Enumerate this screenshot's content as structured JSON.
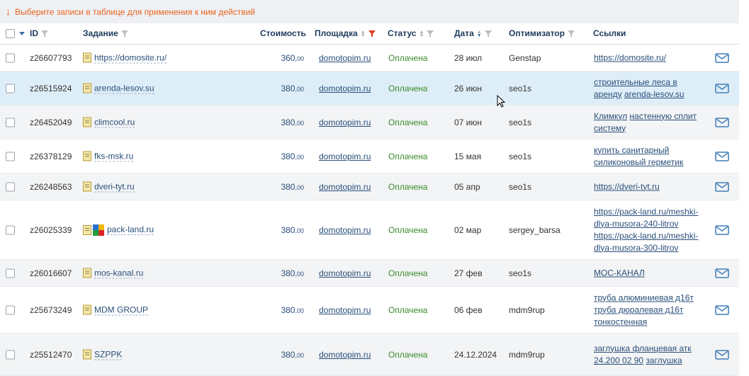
{
  "hint": {
    "arrow": "↓",
    "text": "Выберите записи в таблице для применения к ним действий"
  },
  "columns": {
    "id": "ID",
    "task": "Задание",
    "price": "Стоимость",
    "site": "Площадка",
    "status": "Статус",
    "date": "Дата",
    "optimizer": "Оптимизатор",
    "links": "Ссылки"
  },
  "colors": {
    "header": "#1e3a5c",
    "link": "#2a4f7a",
    "paid": "#3a8a2a",
    "hint": "#e8651c",
    "funnel_active": "#e03a1c",
    "mail": "#5b8fc0"
  },
  "rows": [
    {
      "id": "z26607793",
      "task": "https://domosite.ru/",
      "price_int": "360",
      "price_dec": ",00",
      "site": "domotopim.ru",
      "status": "Оплачена",
      "date": "28 июл",
      "optimizer": "Genstap",
      "links": [
        "https://domosite.ru/"
      ]
    },
    {
      "id": "z26515924",
      "task": "arenda-lesov.su",
      "price_int": "380",
      "price_dec": ",00",
      "site": "domotopim.ru",
      "status": "Оплачена",
      "date": "26 июн",
      "optimizer": "seo1s",
      "links": [
        "строительные леса в аренду",
        "arenda-lesov.su"
      ]
    },
    {
      "id": "z26452049",
      "task": "climcool.ru",
      "price_int": "380",
      "price_dec": ",00",
      "site": "domotopim.ru",
      "status": "Оплачена",
      "date": "07 июн",
      "optimizer": "seo1s",
      "links": [
        "Климкул",
        "настенную сплит систему"
      ]
    },
    {
      "id": "z26378129",
      "task": "fks-msk.ru",
      "price_int": "380",
      "price_dec": ",00",
      "site": "domotopim.ru",
      "status": "Оплачена",
      "date": "15 мая",
      "optimizer": "seo1s",
      "links": [
        "купить санитарный силиконовый герметик"
      ]
    },
    {
      "id": "z26248563",
      "task": "dveri-tyt.ru",
      "price_int": "380",
      "price_dec": ",00",
      "site": "domotopim.ru",
      "status": "Оплачена",
      "date": "05 апр",
      "optimizer": "seo1s",
      "links": [
        "https://dveri-tyt.ru"
      ]
    },
    {
      "id": "z26025339",
      "task": "pack-land.ru",
      "price_int": "380",
      "price_dec": ",00",
      "site": "domotopim.ru",
      "status": "Оплачена",
      "date": "02 мар",
      "optimizer": "sergey_barsa",
      "links": [
        "https://pack-land.ru/meshki-dlya-musora-240-litrov",
        "https://pack-land.ru/meshki-dlya-musora-300-litrov"
      ]
    },
    {
      "id": "z26016607",
      "task": "mos-kanal.ru",
      "price_int": "380",
      "price_dec": ",00",
      "site": "domotopim.ru",
      "status": "Оплачена",
      "date": "27 фев",
      "optimizer": "seo1s",
      "links": [
        "МОС-КАНАЛ"
      ]
    },
    {
      "id": "z25673249",
      "task": "MDM GROUP",
      "price_int": "380",
      "price_dec": ",00",
      "site": "domotopim.ru",
      "status": "Оплачена",
      "date": "06 фев",
      "optimizer": "mdm9rup",
      "links": [
        "труба алюминиевая д16т",
        "труба дюралевая д16т тонкостенная"
      ]
    },
    {
      "id": "z25512470",
      "task": "SZPPK",
      "price_int": "380",
      "price_dec": ",00",
      "site": "domotopim.ru",
      "status": "Оплачена",
      "date": "24.12.2024",
      "optimizer": "mdm9rup",
      "links": [
        "заглушка фланцевая атк 24.200 02 90",
        "заглушка"
      ]
    }
  ]
}
